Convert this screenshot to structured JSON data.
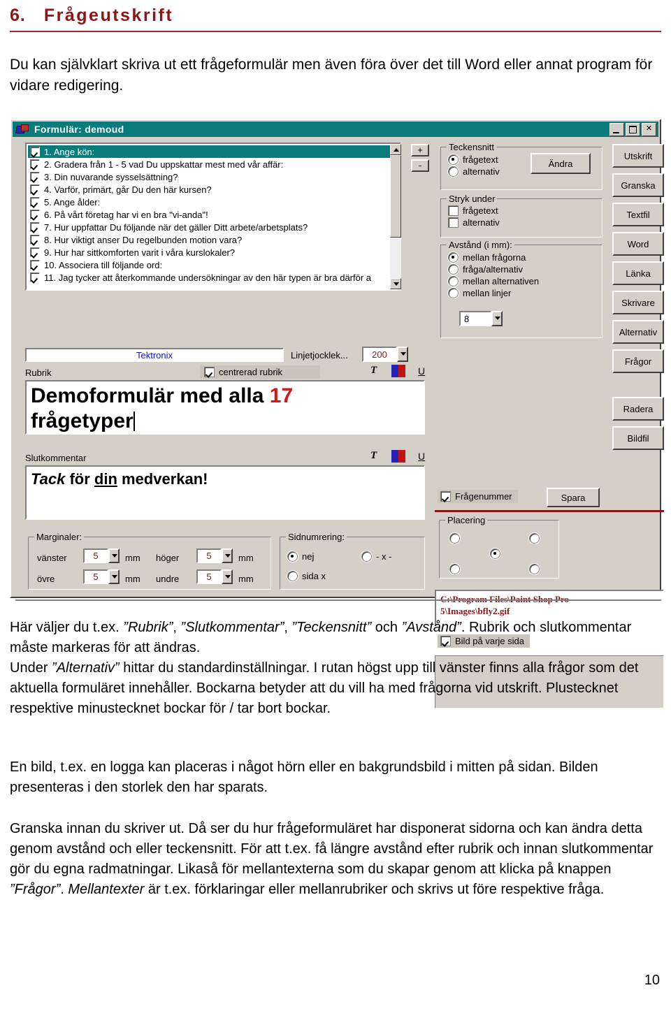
{
  "document": {
    "section_number": "6.",
    "section_title": "Frågeutskrift",
    "intro": "Du kan självklart skriva ut ett frågeformulär men även föra över det till Word eller annat program för vidare redigering.",
    "page_number": "10",
    "paragraphs": {
      "p1_a": "Här väljer du t.ex. ",
      "p1_q1": "”Rubrik”",
      "p1_b": ", ",
      "p1_q2": "”Slutkommentar”",
      "p1_c": ", ",
      "p1_q3": "”Teckensnitt”",
      "p1_d": " och ",
      "p1_q4": "”Avstånd”",
      "p1_e": ". Rubrik och slutkommentar måste markeras för att ändras.",
      "p1_f": "Under ",
      "p1_q5": "”Alternativ”",
      "p1_g": " hittar du standardinställningar. I rutan högst upp till vänster finns alla frågor som det aktuella formuläret innehåller. Bockarna betyder att du vill ha med frågorna vid utskrift. Plustecknet respektive minustecknet bockar för / tar bort bockar.",
      "p2": "En bild, t.ex. en logga kan placeras i något hörn eller en bakgrundsbild i mitten på sidan. Bilden presenteras i den storlek den har sparats.",
      "p3_a": "Granska innan du skriver ut. Då ser du hur frågeformuläret har disponerat sidorna och kan ändra detta genom avstånd och eller teckensnitt. För att t.ex. få längre avstånd efter rubrik och innan slutkommentar gör du egna radmatningar. Likaså för mellantexterna som du skapar genom att klicka på knappen ",
      "p3_q1": "”Frågor”",
      "p3_b": ". ",
      "p3_q2": "Mellantexter",
      "p3_c": " är t.ex. förklaringar eller mellanrubriker och skrivs ut före respektive fråga."
    }
  },
  "dialog": {
    "title": "Formulär: demoud",
    "titlebar_buttons": {
      "minimize": "_",
      "maximize": "□",
      "close": "✕"
    },
    "question_list": [
      {
        "checked": true,
        "selected": true,
        "text": "1. Ange kön:"
      },
      {
        "checked": true,
        "selected": false,
        "text": "2. Gradera från 1 - 5 vad Du uppskattar mest med vår affär:"
      },
      {
        "checked": true,
        "selected": false,
        "text": "3. Din nuvarande sysselsättning?"
      },
      {
        "checked": true,
        "selected": false,
        "text": "4. Varför, primärt, går Du den här kursen?"
      },
      {
        "checked": true,
        "selected": false,
        "text": "5. Ange ålder:"
      },
      {
        "checked": true,
        "selected": false,
        "text": "6. På vårt företag har vi en bra \"vi-anda\"!"
      },
      {
        "checked": true,
        "selected": false,
        "text": "7. Hur uppfattar Du följande när det gäller Ditt arbete/arbetsplats?"
      },
      {
        "checked": true,
        "selected": false,
        "text": "8. Hur viktigt anser Du regelbunden motion vara?"
      },
      {
        "checked": true,
        "selected": false,
        "text": "9. Hur har sittkomforten varit i våra kurslokaler?"
      },
      {
        "checked": true,
        "selected": false,
        "text": "10. Associera till följande ord:"
      },
      {
        "checked": true,
        "selected": false,
        "text": "11. Jag tycker att återkommande undersökningar av den här typen är bra därför a"
      }
    ],
    "check_buttons": {
      "plus": "+",
      "minus": "-"
    },
    "teckensnitt": {
      "legend": "Teckensnitt",
      "options": [
        {
          "label": "frågetext",
          "selected": true
        },
        {
          "label": "alternativ",
          "selected": false
        }
      ],
      "change_button": "Ändra"
    },
    "stryk_under": {
      "legend": "Stryk under",
      "options": [
        {
          "label": "frågetext",
          "checked": false
        },
        {
          "label": "alternativ",
          "checked": false
        }
      ]
    },
    "avstand": {
      "legend": "Avstånd (i mm):",
      "options": [
        {
          "label": "mellan frågorna",
          "selected": true
        },
        {
          "label": "fråga/alternativ",
          "selected": false
        },
        {
          "label": "mellan alternativen",
          "selected": false
        },
        {
          "label": "mellan linjer",
          "selected": false
        }
      ],
      "value": "8"
    },
    "right_buttons": [
      "Utskrift",
      "Granska",
      "Textfil",
      "Word",
      "Länka",
      "Skrivare",
      "Alternativ",
      "Frågor",
      "Radera",
      "Bildfil"
    ],
    "tektronix_field": "Tektronix",
    "linjetjocklek_label": "Linjetjocklek...",
    "linjetjocklek_value": "200",
    "rubrik": {
      "label": "Rubrik",
      "centered_checkbox": {
        "label": "centrerad rubrik",
        "checked": true
      },
      "text_plain": "Demoformulär med alla ",
      "text_number": "17",
      "text_line2": "frågetyper",
      "toolbar": {
        "font": "T",
        "color": "color-swatch",
        "underline": "U"
      }
    },
    "slutkommentar": {
      "label": "Slutkommentar",
      "text_italic": "Tack",
      "text_mid": " för ",
      "text_underline": "din",
      "text_end": " medverkan!",
      "toolbar": {
        "font": "T",
        "color": "color-swatch",
        "underline": "U"
      }
    },
    "marginaler": {
      "legend": "Marginaler:",
      "fields": [
        {
          "label": "vänster",
          "value": "5",
          "unit": "mm"
        },
        {
          "label": "höger",
          "value": "5",
          "unit": "mm"
        },
        {
          "label": "övre",
          "value": "5",
          "unit": "mm"
        },
        {
          "label": "undre",
          "value": "5",
          "unit": "mm"
        }
      ]
    },
    "sidnumrering": {
      "legend": "Sidnumrering:",
      "options": [
        {
          "label": "nej",
          "selected": true
        },
        {
          "label": "- x -",
          "selected": false
        },
        {
          "label": "sida x",
          "selected": false
        }
      ]
    },
    "fragenummer": {
      "label": "Frågenummer",
      "checked": true
    },
    "spara_button": "Spara",
    "fragor_button": "Frågor",
    "placering": {
      "legend": "Placering",
      "selected": "center"
    },
    "image_path_line1": "C:\\Program Files\\Paint Shop Pro",
    "image_path_line2": "5\\Images\\bfly2.gif",
    "bild_varje_sida": {
      "label": "Bild på varje sida",
      "checked": true
    }
  },
  "colors": {
    "heading": "#8c1616",
    "titlebar": "#0a7b7b",
    "dialog_face": "#d4d0c8",
    "red_text": "#8c1616",
    "rubrik_number": "#d31717",
    "tektronix_text": "#1414b4"
  }
}
